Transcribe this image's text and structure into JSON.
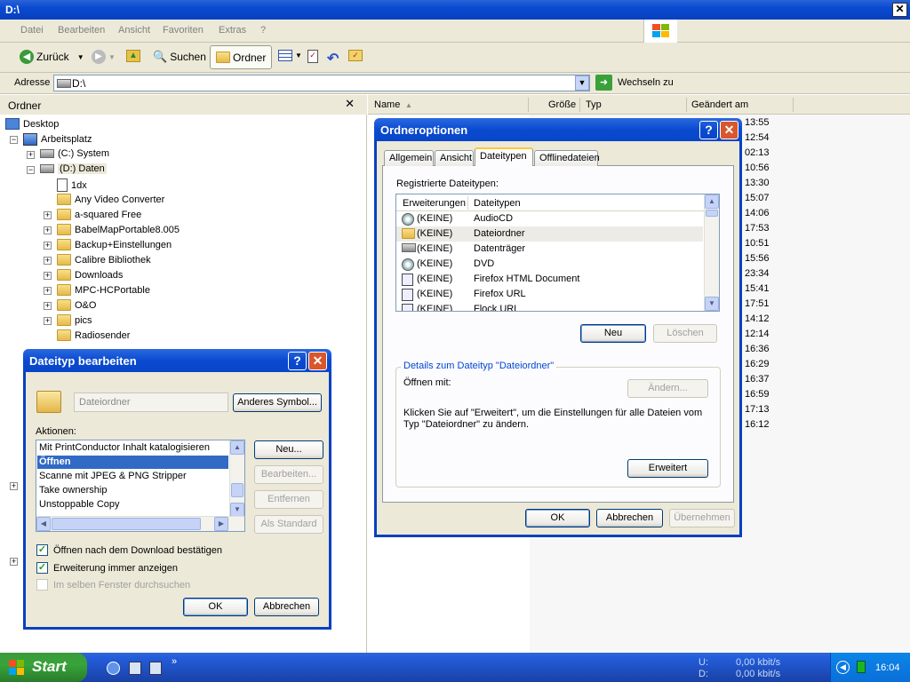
{
  "window": {
    "title": "D:\\",
    "close": "✕"
  },
  "menu": [
    "Datei",
    "Bearbeiten",
    "Ansicht",
    "Favoriten",
    "Extras",
    "?"
  ],
  "toolbar": {
    "back": "Zurück",
    "search": "Suchen",
    "folders": "Ordner"
  },
  "address": {
    "label": "Adresse",
    "value": "D:\\",
    "go": "Wechseln zu"
  },
  "folder_pane": {
    "title": "Ordner",
    "tree": [
      "Desktop",
      "Arbeitsplatz",
      "(C:) System",
      "(D:) Daten",
      "1dx",
      "Any Video Converter",
      "a-squared Free",
      "BabelMapPortable8.005",
      "Backup+Einstellungen",
      "Calibre Bibliothek",
      "Downloads",
      "MPC-HCPortable",
      "O&O",
      "pics",
      "Radiosender"
    ]
  },
  "file_pane": {
    "columns": [
      "Name",
      "Größe",
      "Typ",
      "Geändert am"
    ],
    "times": [
      "13:55",
      "12:54",
      "02:13",
      "10:56",
      "13:30",
      "15:07",
      "14:06",
      "17:53",
      "10:51",
      "15:56",
      "23:34",
      "15:41",
      "17:51",
      "14:12",
      "12:14",
      "16:36",
      "16:29",
      "16:37",
      "16:59",
      "17:13",
      "16:12"
    ]
  },
  "folder_options": {
    "title": "Ordneroptionen",
    "tabs": [
      "Allgemein",
      "Ansicht",
      "Dateitypen",
      "Offlinedateien"
    ],
    "registered_label": "Registrierte Dateitypen:",
    "list_headers": [
      "Erweiterungen",
      "Dateitypen"
    ],
    "rows": [
      {
        "ext": "(KEINE)",
        "type": "AudioCD"
      },
      {
        "ext": "(KEINE)",
        "type": "Dateiordner"
      },
      {
        "ext": "(KEINE)",
        "type": "Datenträger"
      },
      {
        "ext": "(KEINE)",
        "type": "DVD"
      },
      {
        "ext": "(KEINE)",
        "type": "Firefox HTML Document"
      },
      {
        "ext": "(KEINE)",
        "type": "Firefox URL"
      },
      {
        "ext": "(KEINE)",
        "type": "Flock URL"
      }
    ],
    "new_btn": "Neu",
    "delete_btn": "Löschen",
    "details_title": "Details zum Dateityp \"Dateiordner\"",
    "open_with": "Öffnen mit:",
    "change_btn": "Ändern...",
    "details_text1": "Klicken Sie auf \"Erweitert\", um die Einstellungen für alle Dateien vom",
    "details_text2": "Typ \"Dateiordner\" zu ändern.",
    "advanced_btn": "Erweitert",
    "ok": "OK",
    "cancel": "Abbrechen",
    "apply": "Übernehmen"
  },
  "edit_type": {
    "title": "Dateityp bearbeiten",
    "name_value": "Dateiordner",
    "change_icon": "Anderes Symbol...",
    "actions_label": "Aktionen:",
    "actions": [
      "Mit PrintConductor Inhalt katalogisieren",
      "Öffnen",
      "Scanne mit JPEG & PNG Stripper",
      "Take ownership",
      "Unstoppable Copy"
    ],
    "btn_new": "Neu...",
    "btn_edit": "Bearbeiten...",
    "btn_remove": "Entfernen",
    "btn_default": "Als Standard",
    "chk1": "Öffnen nach dem Download bestätigen",
    "chk2": "Erweiterung immer anzeigen",
    "chk3": "Im selben Fenster durchsuchen",
    "ok": "OK",
    "cancel": "Abbrechen"
  },
  "taskbar": {
    "start": "Start",
    "up_label": "U:",
    "down_label": "D:",
    "up_rate": "0,00 kbit/s",
    "down_rate": "0,00 kbit/s",
    "clock": "16:04"
  }
}
